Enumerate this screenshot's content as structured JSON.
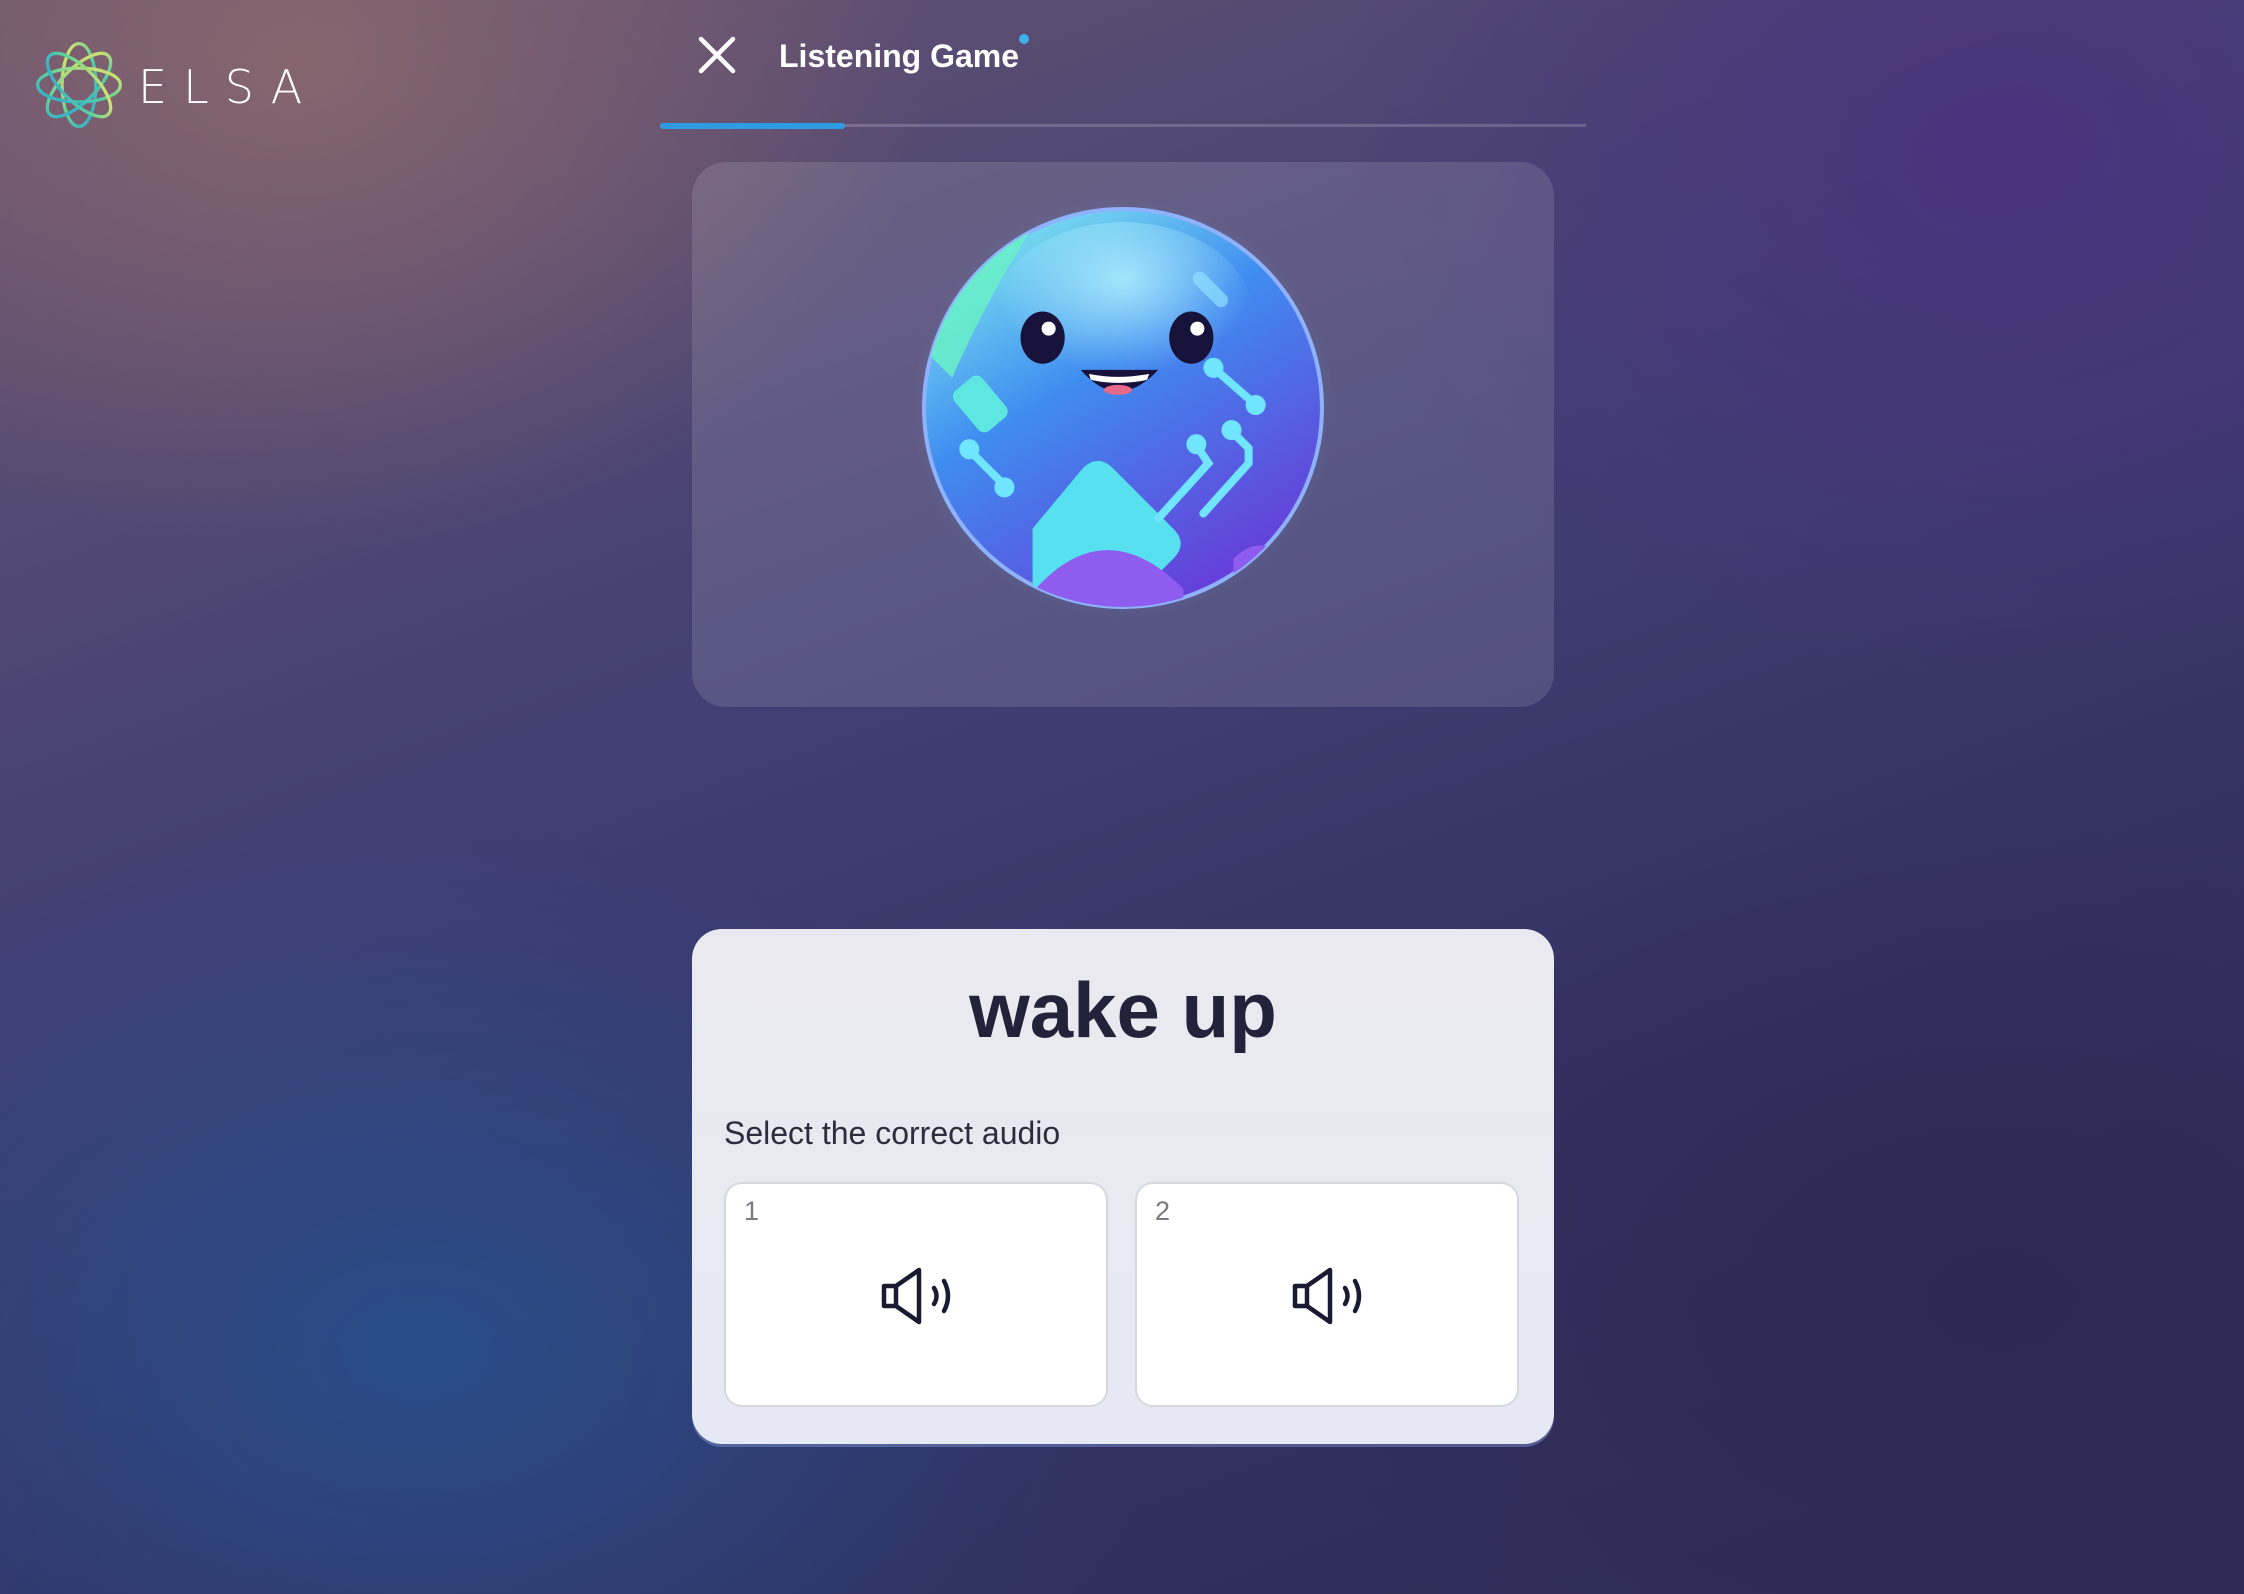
{
  "logo": {
    "text": "ELSA",
    "icon": "elsa-logo-mark"
  },
  "header": {
    "title": "Listening Game",
    "close_icon": "close-icon",
    "progress": 0.2,
    "progress_color": "#2f9be3"
  },
  "mascot": {
    "icon": "planet-mascot"
  },
  "question": {
    "word": "wake up",
    "instruction": "Select the correct audio",
    "options": [
      {
        "number": "1",
        "icon": "speaker-icon"
      },
      {
        "number": "2",
        "icon": "speaker-icon"
      }
    ]
  }
}
